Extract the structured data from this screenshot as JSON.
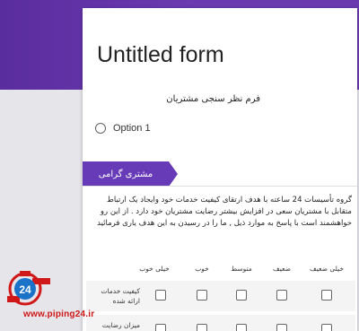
{
  "form": {
    "title": "Untitled form",
    "description": "فرم نظر سنجی مشتریان",
    "option_label": "Option 1"
  },
  "section": {
    "title": "مشتری گرامی",
    "description": "گروه تأسیسات 24 ساعته با هدف ارتقای کیفیت خدمات خود وایجاد یک ارتباط متقابل با مشتریان سعی در افزایش بیشتر رضایت مشتریان خود دارد . از این رو خواهشمند است با پاسخ به موارد ذیل , ما را در رسیدن به این هدف یاری فرمائید"
  },
  "grid": {
    "columns": [
      "خیلی خوب",
      "خوب",
      "متوسط",
      "ضعیف",
      "خیلی ضعیف"
    ],
    "rows": [
      "کیفیت خدمات ارائه شده",
      "میزان رضایت شما"
    ]
  },
  "watermark": {
    "text": "www.piping24.ir",
    "logo_text": "24",
    "colors": {
      "red": "#d01818",
      "blue": "#1a73c8"
    }
  },
  "colors": {
    "header_purple": "#5a2d9e",
    "section_purple": "#673ab7"
  }
}
